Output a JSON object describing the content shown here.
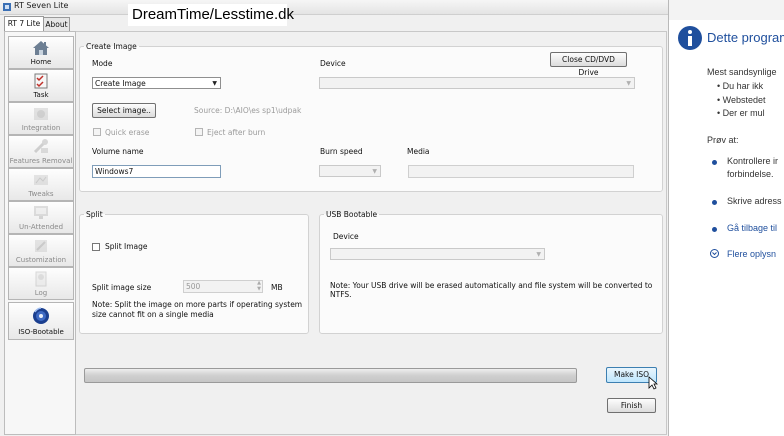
{
  "window": {
    "title": "RT Seven Lite",
    "controls": [
      "–",
      "□",
      "✕"
    ]
  },
  "watermark": "DreamTime/Lesstime.dk",
  "tabs": [
    {
      "label": "RT 7 Lite",
      "active": true
    },
    {
      "label": "About",
      "active": false
    }
  ],
  "sidebar": {
    "items": [
      {
        "label": "Home",
        "icon": "house-icon",
        "enabled": true
      },
      {
        "label": "Task",
        "icon": "checklist-icon",
        "enabled": true
      },
      {
        "label": "Integration",
        "icon": "integration-icon",
        "enabled": false
      },
      {
        "label": "Features Removal",
        "icon": "tools-icon",
        "enabled": false
      },
      {
        "label": "Tweaks",
        "icon": "tweaks-icon",
        "enabled": false
      },
      {
        "label": "Un-Attended",
        "icon": "monitor-icon",
        "enabled": false
      },
      {
        "label": "Customization",
        "icon": "customization-icon",
        "enabled": false
      },
      {
        "label": "Log",
        "icon": "log-icon",
        "enabled": false
      },
      {
        "label": "ISO-Bootable",
        "icon": "disc-icon",
        "enabled": true
      }
    ]
  },
  "create_image": {
    "legend": "Create Image",
    "mode_label": "Mode",
    "mode_value": "Create Image",
    "device_label": "Device",
    "device_value": "",
    "close_drive_button": "Close CD/DVD Drive",
    "select_image_button": "Select image..",
    "source_text": "Source: D:\\AIO\\es sp1\\udpak",
    "quick_erase_label": "Quick erase",
    "eject_label": "Eject after burn",
    "volume_name_label": "Volume name",
    "volume_name_value": "Windows7",
    "burn_speed_label": "Burn speed",
    "media_label": "Media"
  },
  "split": {
    "legend": "Split",
    "split_image_label": "Split Image",
    "split_size_label": "Split image size",
    "split_size_value": "500",
    "unit": "MB",
    "note": "Note: Split the image on more parts if operating system size cannot fit on a single media"
  },
  "usb": {
    "legend": "USB Bootable",
    "device_label": "Device",
    "note": "Note: Your USB drive will be erased automatically and file system will be converted to NTFS."
  },
  "progress": {
    "value": 0
  },
  "buttons": {
    "make_iso": "Make ISO",
    "finish": "Finish"
  },
  "ie_panel": {
    "title": "Dette program",
    "intro": "Mest sandsynlige",
    "causes": [
      "Du har ikk",
      "Webstedet",
      "Der er mul"
    ],
    "try_label": "Prøv at:",
    "actions": [
      {
        "line1": "Kontrollere ir",
        "line2": "forbindelse."
      },
      {
        "line1": "Skrive adress",
        "line2": ""
      },
      {
        "line1": "Gå tilbage til",
        "line2": ""
      },
      {
        "line1": "Flere oplysn",
        "line2": ""
      }
    ]
  },
  "colors": {
    "accent": "#1f4f9d",
    "window_bg": "#f0f0f0"
  }
}
